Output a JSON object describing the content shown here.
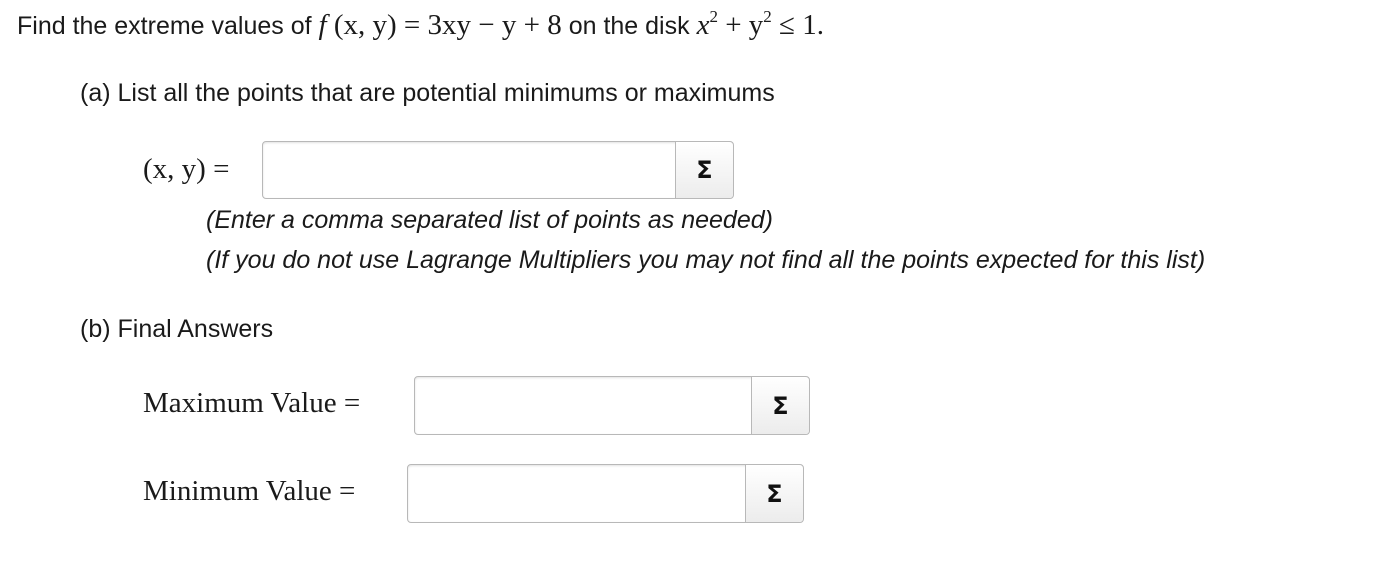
{
  "question": {
    "prefix": "Find the extreme values of ",
    "func_f": "f",
    "func_args": " (x, y) = 3xy − y + 8",
    "middle": " on the disk ",
    "x": "x",
    "exp1": "2",
    "plus_y": " + y",
    "exp2": "2",
    "tail": " ≤ 1."
  },
  "part_a": {
    "label": "(a) List all the points that are potential minimums or maximums",
    "field_label": "(x, y) =",
    "field_value": "",
    "sigma_icon": "Σ",
    "hint1": "(Enter a comma separated list of points as needed)",
    "hint2": "(If you do not use Lagrange Multipliers you may not find all the points expected for this list)"
  },
  "part_b": {
    "label": "(b) Final Answers",
    "max_label": "Maximum Value =",
    "max_value": "",
    "min_label": "Minimum Value =",
    "min_value": "",
    "sigma_icon": "Σ"
  }
}
